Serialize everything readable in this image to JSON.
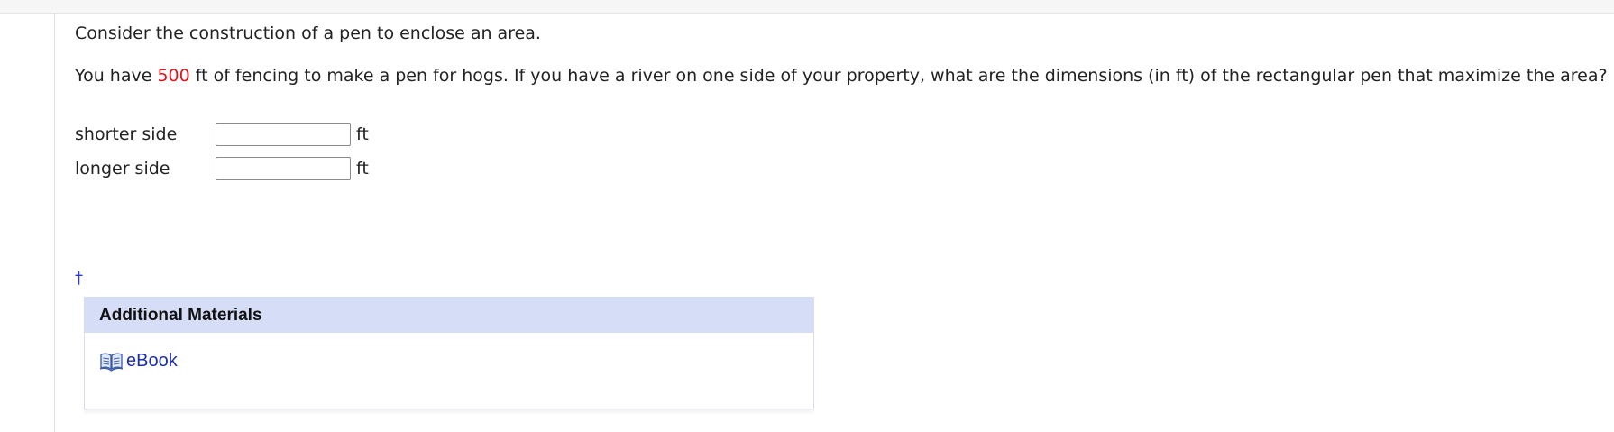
{
  "question": {
    "intro": "Consider the construction of a pen to enclose an area.",
    "text_before": "You have ",
    "highlight_value": "500",
    "text_after": " ft of fencing to make a pen for hogs. If you have a river on one side of your property, what are the dimensions (in ft) of the rectangular pen that maximize the area?",
    "highlight_color": "#e8121a"
  },
  "answers": [
    {
      "label": "shorter side",
      "value": "",
      "unit": "ft"
    },
    {
      "label": "longer side",
      "value": "",
      "unit": "ft"
    }
  ],
  "footnote_marker": "†",
  "additional_materials": {
    "title": "Additional Materials",
    "links": [
      {
        "label": "eBook",
        "icon": "book-icon"
      }
    ]
  }
}
